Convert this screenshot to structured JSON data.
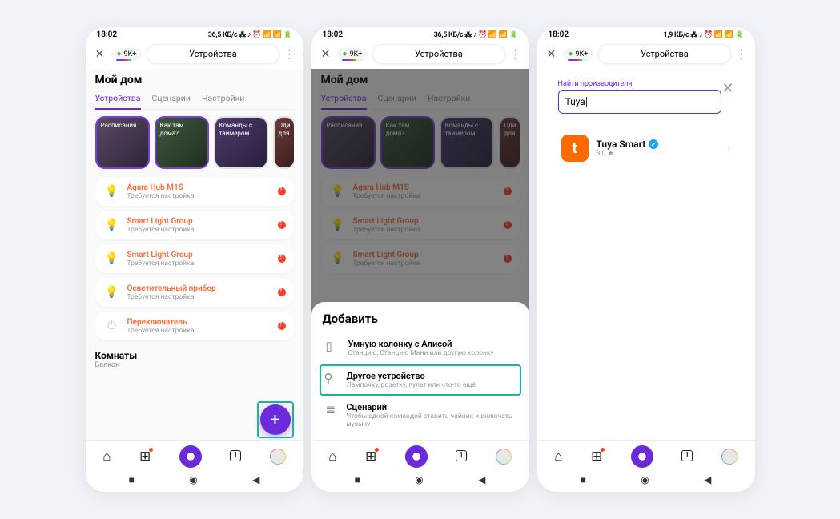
{
  "s1": {
    "time": "18:02",
    "status": "36,5 КБ/с ⁂ ♪ ⏰ 📶 📶 🔋",
    "chip": "9K+",
    "title": "Устройства",
    "home": "Мой дом",
    "tabs": {
      "devices": "Устройства",
      "scenes": "Сценарии",
      "settings": "Настройки"
    },
    "cards": {
      "c1": "Расписания",
      "c2": "Как там дома?",
      "c3": "Команды с таймером",
      "c4": "Оди\nдля"
    },
    "devices": [
      {
        "name": "Aqara Hub M1S",
        "sub": "Требуется настройка"
      },
      {
        "name": "Smart Light Group",
        "sub": "Требуется настройка"
      },
      {
        "name": "Smart Light Group",
        "sub": "Требуется настройка"
      },
      {
        "name": "Осветительный прибор",
        "sub": "Требуется настройка"
      },
      {
        "name": "Переключатель",
        "sub": "Требуется настройка"
      }
    ],
    "rooms": {
      "t": "Комнаты",
      "s": "Балкон"
    }
  },
  "s2": {
    "time": "18:02",
    "status": "36,5 КБ/с ⁂ ♪ ⏰ 📶 📶 🔋",
    "chip": "9K+",
    "title": "Устройства",
    "home": "Мой дом",
    "sheet": {
      "title": "Добавить",
      "i1": {
        "t": "Умную колонку с Алисой",
        "s": "Станцию, Станцию Мини или другую колонку"
      },
      "i2": {
        "t": "Другое устройство",
        "s": "Лампочку, розетку, пульт или что-то ещё"
      },
      "i3": {
        "t": "Сценарий",
        "s": "Чтобы одной командой ставить чайник и включать музыку"
      }
    }
  },
  "s3": {
    "time": "18:02",
    "status": "1,9 КБ/с ⁂ ♪ ⏰ 📶 📶 🔋",
    "chip": "9K+",
    "title": "Устройства",
    "search": {
      "label": "Найти производителя",
      "value": "Tuya"
    },
    "result": {
      "name": "Tuya Smart",
      "rating": "3,0 ★"
    }
  }
}
